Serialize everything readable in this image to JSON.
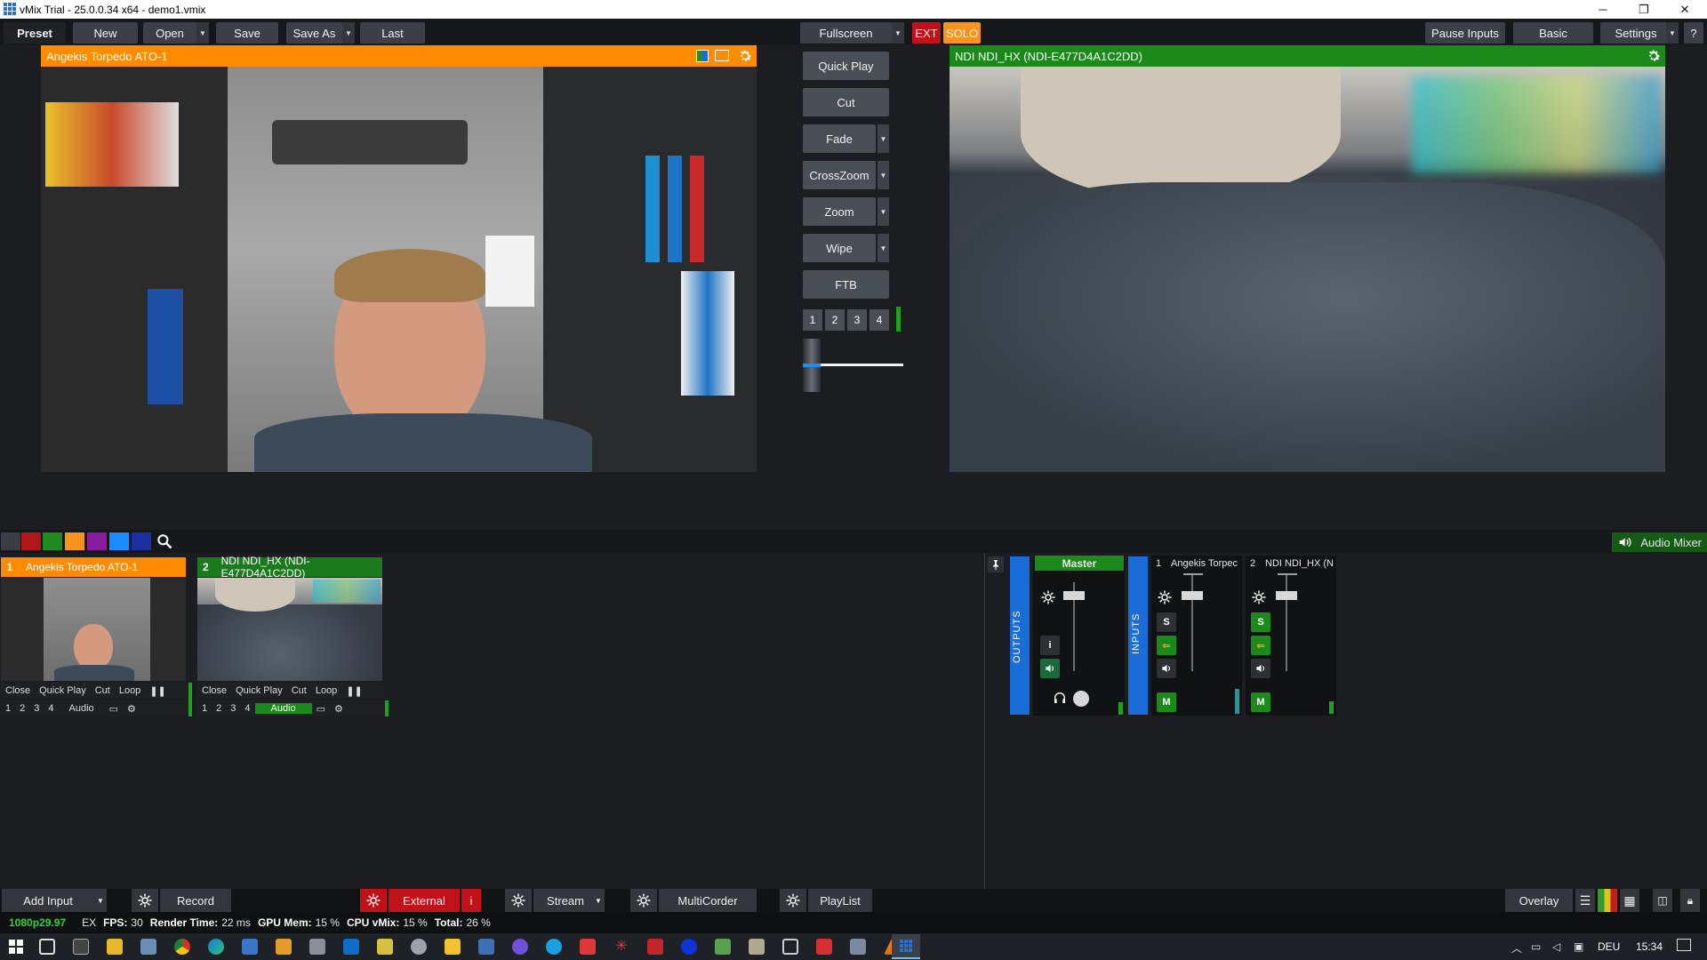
{
  "window": {
    "title": "vMix Trial - 25.0.0.34 x64 - demo1.vmix",
    "minimize": "─",
    "restore": "❐",
    "close": "✕"
  },
  "toolbar": {
    "preset": "Preset",
    "new": "New",
    "open": "Open",
    "save": "Save",
    "save_as": "Save As",
    "last": "Last",
    "fullscreen": "Fullscreen",
    "ext": "EXT",
    "solo": "SOLO",
    "pause_inputs": "Pause Inputs",
    "basic": "Basic",
    "settings": "Settings",
    "help": "?"
  },
  "preview": {
    "title": "Angekis Torpedo ATO-1",
    "accent": "#ff8c00"
  },
  "output": {
    "title": "NDI NDI_HX (NDI-E477D4A1C2DD)",
    "accent": "#1b8a1b"
  },
  "transitions": {
    "quick_play": "Quick Play",
    "cut": "Cut",
    "fade": "Fade",
    "crosszoom": "CrossZoom",
    "zoom": "Zoom",
    "wipe": "Wipe",
    "ftb": "FTB",
    "numbers": [
      "1",
      "2",
      "3",
      "4"
    ],
    "tbar_position": 0
  },
  "filters": {
    "colors": [
      "#3a3d42",
      "#b01818",
      "#1f8a1f",
      "#f7941d",
      "#8a1aa0",
      "#1a8cff",
      "#1a2fa0"
    ]
  },
  "inputs": [
    {
      "number": "1",
      "title": "Angekis Torpedo ATO-1",
      "state": "preview",
      "controls": [
        "Close",
        "Quick Play",
        "Cut",
        "Loop"
      ],
      "overlays": [
        "1",
        "2",
        "3",
        "4"
      ],
      "audio": "Audio"
    },
    {
      "number": "2",
      "title": "NDI NDI_HX (NDI-E477D4A1C2DD)",
      "state": "program",
      "controls": [
        "Close",
        "Quick Play",
        "Cut",
        "Loop"
      ],
      "overlays": [
        "1",
        "2",
        "3",
        "4"
      ],
      "audio": "Audio"
    }
  ],
  "mixer": {
    "title": "Audio Mixer",
    "outputs_label": "OUTPUTS",
    "inputs_label": "INPUTS",
    "master": "Master",
    "info": "i",
    "channels": [
      {
        "number": "1",
        "name": "Angekis Torpec",
        "solo": "S",
        "mute": "M",
        "solo_active": false
      },
      {
        "number": "2",
        "name": "NDI NDI_HX (N",
        "solo": "S",
        "mute": "M",
        "solo_active": true
      }
    ]
  },
  "bottom": {
    "add_input": "Add Input",
    "record": "Record",
    "external": "External",
    "info": "i",
    "stream": "Stream",
    "multicorder": "MultiCorder",
    "playlist": "PlayList",
    "overlay": "Overlay"
  },
  "status": {
    "format": "1080p29.97",
    "ex": "EX",
    "fps_label": "FPS:",
    "fps": "30",
    "render_label": "Render Time:",
    "render": "22 ms",
    "gpu_label": "GPU Mem:",
    "gpu": "15 %",
    "cpu_label": "CPU vMix:",
    "cpu": "15 %",
    "total_label": "Total:",
    "total": "26 %"
  },
  "taskbar": {
    "language": "DEU",
    "time": "15:34"
  },
  "icons": {
    "gear": "gear-icon",
    "search": "search-icon",
    "speaker": "speaker-icon",
    "headphones": "headphones-icon",
    "pin": "pin-icon"
  }
}
